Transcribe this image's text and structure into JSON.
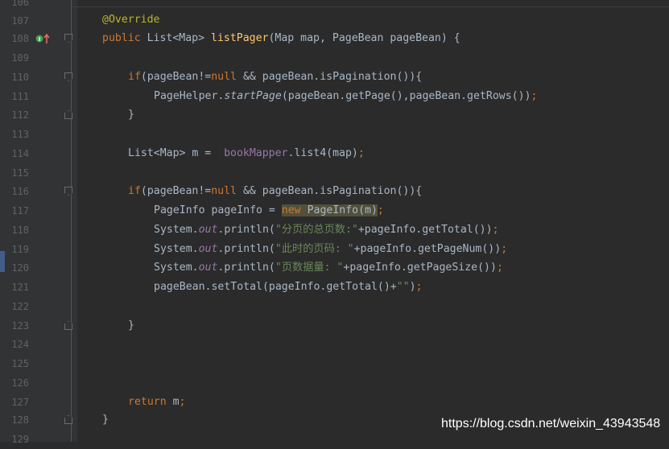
{
  "editor": {
    "lines": [
      {
        "num": "106",
        "text": ""
      },
      {
        "num": "107",
        "text": "@Override"
      },
      {
        "num": "108",
        "text": "public List<Map> listPager(Map map, PageBean pageBean) {"
      },
      {
        "num": "109",
        "text": ""
      },
      {
        "num": "110",
        "text": "if(pageBean!=null && pageBean.isPagination()){"
      },
      {
        "num": "111",
        "text": "PageHelper.startPage(pageBean.getPage(),pageBean.getRows());"
      },
      {
        "num": "112",
        "text": "}"
      },
      {
        "num": "113",
        "text": ""
      },
      {
        "num": "114",
        "text": "List<Map> m =  bookMapper.list4(map);"
      },
      {
        "num": "115",
        "text": ""
      },
      {
        "num": "116",
        "text": "if(pageBean!=null && pageBean.isPagination()){"
      },
      {
        "num": "117",
        "text": "PageInfo pageInfo = new PageInfo(m);"
      },
      {
        "num": "118",
        "text": "System.out.println(\"分页的总页数:\"+pageInfo.getTotal());"
      },
      {
        "num": "119",
        "text": "System.out.println(\"此时的页码: \"+pageInfo.getPageNum());"
      },
      {
        "num": "120",
        "text": "System.out.println(\"页数据量: \"+pageInfo.getPageSize());"
      },
      {
        "num": "121",
        "text": "pageBean.setTotal(pageInfo.getTotal()+\"\");"
      },
      {
        "num": "122",
        "text": ""
      },
      {
        "num": "123",
        "text": "}"
      },
      {
        "num": "124",
        "text": ""
      },
      {
        "num": "125",
        "text": ""
      },
      {
        "num": "126",
        "text": ""
      },
      {
        "num": "127",
        "text": "return m;"
      },
      {
        "num": "128",
        "text": "}"
      },
      {
        "num": "129",
        "text": ""
      }
    ],
    "tokens": {
      "override": "@Override",
      "public": "public",
      "list_map": "List<Map>",
      "method": "listPager",
      "params": "(Map map, PageBean pageBean) {",
      "if": "if",
      "cond_a": "(pageBean!=",
      "null": "null",
      "cond_b": " && pageBean.isPagination()){",
      "pagehelper": "PageHelper.",
      "startpage": "startPage",
      "startpage_args": "(pageBean.getPage(),pageBean.getRows())",
      "semi": ";",
      "close": "}",
      "list_decl": "List<Map> m =  ",
      "mapper": "bookMapper",
      "mapper_call": ".list4(map)",
      "pageinfo_decl": "PageInfo pageInfo = ",
      "new": "new",
      "new_rest": " PageInfo(m)",
      "system": "System.",
      "out": "out",
      "println": ".println(",
      "str1": "\"分页的总页数:\"",
      "str2": "\"此时的页码: \"",
      "str3": "\"页数据量: \"",
      "call1": "+pageInfo.getTotal())",
      "call2": "+pageInfo.getPageNum())",
      "call3": "+pageInfo.getPageSize())",
      "settotal": "pageBean.setTotal(pageInfo.getTotal()+",
      "empty_str": "\"\"",
      "paren_close": ")",
      "return": "return",
      "return_rest": " m"
    }
  },
  "watermark": "https://blog.csdn.net/weixin_43943548",
  "colors": {
    "background": "#2b2b2b",
    "keyword": "#cc7832",
    "annotation": "#bbb529",
    "method": "#ffc66d",
    "string": "#6a8759",
    "field": "#9876aa",
    "text": "#a9b7c6"
  },
  "icons": {
    "gutter_108": "override-implements-icon"
  }
}
